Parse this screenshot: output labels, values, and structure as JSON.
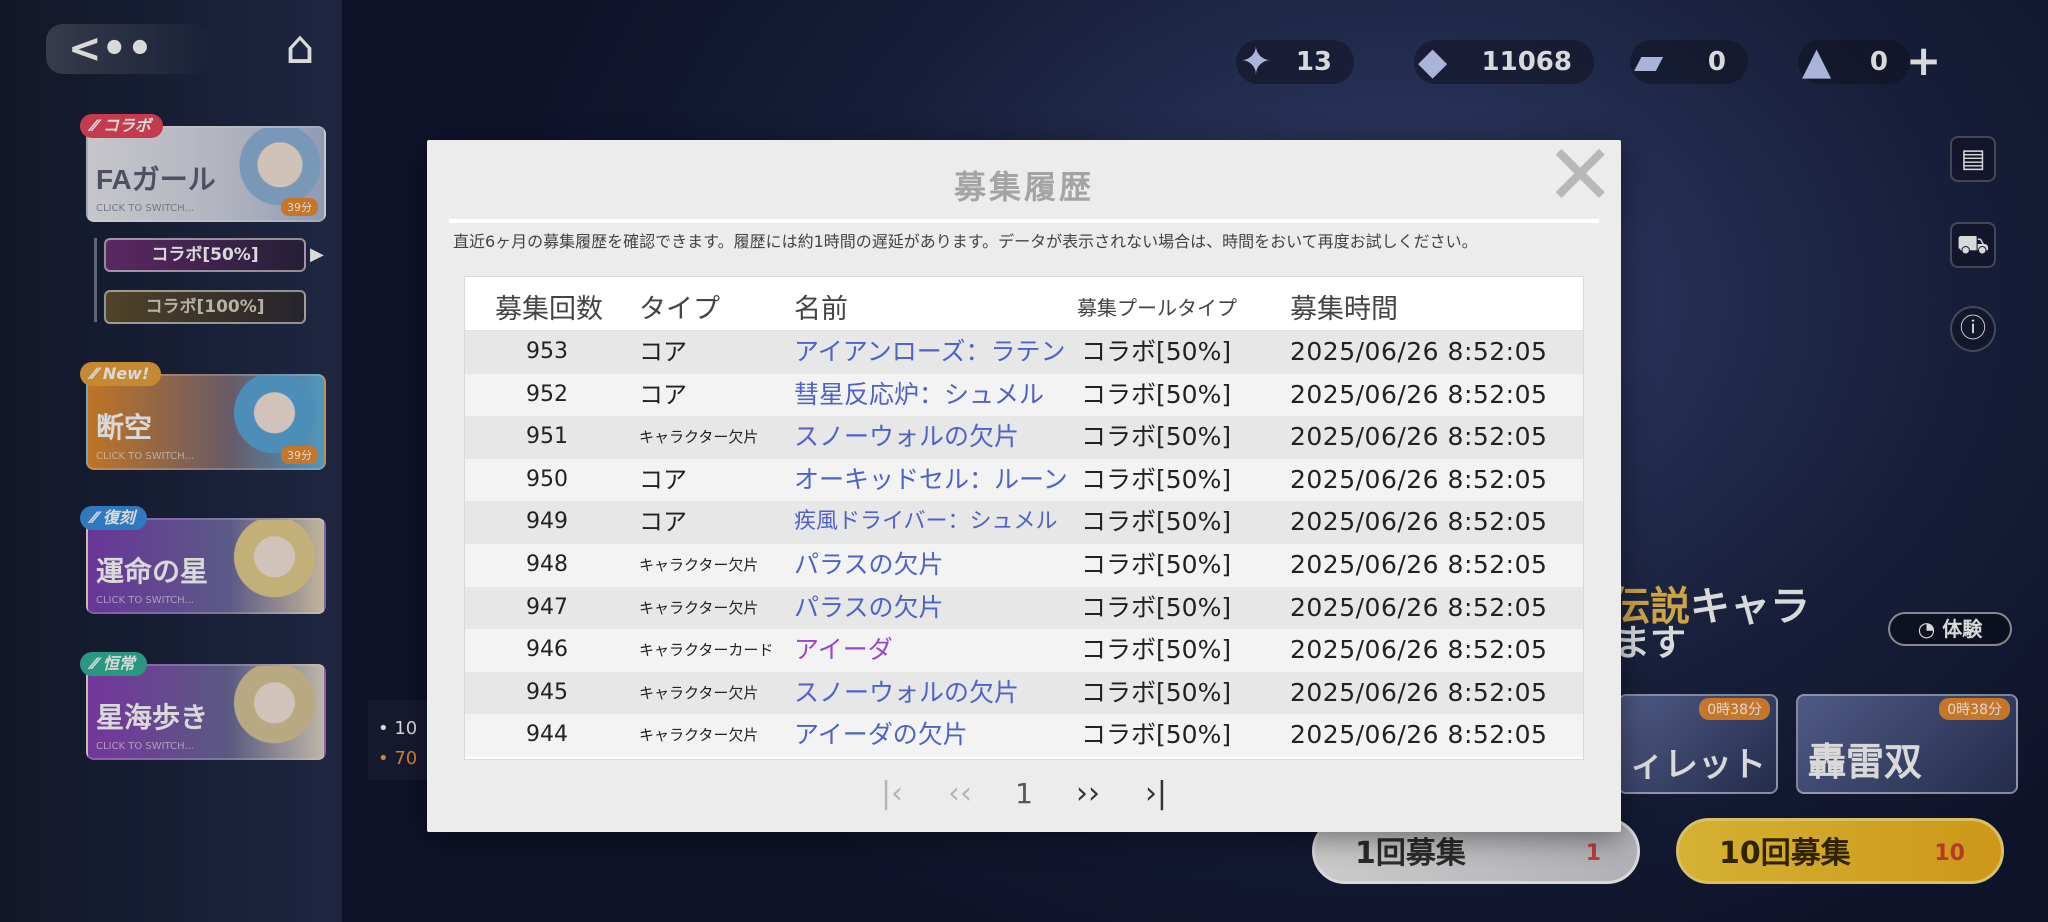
{
  "nav": {
    "back_glyph": "<••",
    "home_glyph": "⌂"
  },
  "banners": [
    {
      "tag": "⁄⁄ コラボ",
      "name": "FAガール",
      "sub": "CLICK TO SWITCH...",
      "timer": "39分"
    },
    {
      "tag": "⁄⁄ New!",
      "name": "断空",
      "sub": "CLICK TO SWITCH...",
      "timer": "39分"
    },
    {
      "tag": "⁄⁄ 復刻",
      "name": "運命の星",
      "sub": "CLICK TO SWITCH..."
    },
    {
      "tag": "⁄⁄ 恒常",
      "name": "星海歩き",
      "sub": "CLICK TO SWITCH..."
    }
  ],
  "collab_tabs": [
    "コラボ[50%]",
    "コラボ[100%]"
  ],
  "currencies": [
    {
      "icon": "star-shard-icon",
      "value": "13"
    },
    {
      "icon": "crystal-icon",
      "value": "11068"
    },
    {
      "icon": "ticket-icon",
      "value": "0"
    },
    {
      "icon": "special-ticket-icon",
      "value": "0"
    }
  ],
  "plus": "+",
  "right_icons": [
    "document-icon",
    "cart-icon",
    "info-icon"
  ],
  "background": {
    "legend_prefix": "伝説",
    "legend_suffix": "キャラ",
    "legend_line2": "ます",
    "trial_label": "体験",
    "cards": [
      {
        "timer": "0時38分",
        "name": "ィレット"
      },
      {
        "timer": "0時38分",
        "name": "轟雷双"
      }
    ],
    "pull_one": {
      "label": "1回募集",
      "count": "1"
    },
    "pull_ten": {
      "label": "10回募集",
      "count": "10"
    },
    "left_note": [
      "• 10",
      "• 70"
    ]
  },
  "modal": {
    "title": "募集履歴",
    "description": "直近6ヶ月の募集履歴を確認できます。履歴には約1時間の遅延があります。データが表示されない場合は、時間をおいて再度お試しください。",
    "columns": [
      "募集回数",
      "タイプ",
      "名前",
      "募集プールタイプ",
      "募集時間"
    ],
    "rows": [
      {
        "count": "953",
        "type": "コア",
        "name": "アイアンローズ：ラテン",
        "pool": "コラボ[50%]",
        "time": "2025/06/26 8:52:05"
      },
      {
        "count": "952",
        "type": "コア",
        "name": "彗星反応炉：シュメル",
        "pool": "コラボ[50%]",
        "time": "2025/06/26 8:52:05"
      },
      {
        "count": "951",
        "type": "キャラクター欠片",
        "name": "スノーウォルの欠片",
        "pool": "コラボ[50%]",
        "time": "2025/06/26 8:52:05"
      },
      {
        "count": "950",
        "type": "コア",
        "name": "オーキッドセル：ルーン",
        "pool": "コラボ[50%]",
        "time": "2025/06/26 8:52:05"
      },
      {
        "count": "949",
        "type": "コア",
        "name": "疾風ドライバー：シュメル",
        "pool": "コラボ[50%]",
        "time": "2025/06/26 8:52:05"
      },
      {
        "count": "948",
        "type": "キャラクター欠片",
        "name": "パラスの欠片",
        "pool": "コラボ[50%]",
        "time": "2025/06/26 8:52:05"
      },
      {
        "count": "947",
        "type": "キャラクター欠片",
        "name": "パラスの欠片",
        "pool": "コラボ[50%]",
        "time": "2025/06/26 8:52:05"
      },
      {
        "count": "946",
        "type": "キャラクターカード",
        "name": "アイーダ",
        "pool": "コラボ[50%]",
        "time": "2025/06/26 8:52:05"
      },
      {
        "count": "945",
        "type": "キャラクター欠片",
        "name": "スノーウォルの欠片",
        "pool": "コラボ[50%]",
        "time": "2025/06/26 8:52:05"
      },
      {
        "count": "944",
        "type": "キャラクター欠片",
        "name": "アイーダの欠片",
        "pool": "コラボ[50%]",
        "time": "2025/06/26 8:52:05"
      }
    ],
    "pagination": {
      "first": "|‹",
      "prev": "‹‹",
      "page": "1",
      "next": "››",
      "last": "›|"
    }
  },
  "colors": {
    "name_blue": "#4f63c7",
    "name_purple": "#9a48c8",
    "tag_collab": "#e8455a",
    "tag_new": "#e7a23a",
    "tag_rerun": "#3a8fe0",
    "tag_standard": "#2fb39a",
    "pull_ten_bg": "#f6c531"
  }
}
